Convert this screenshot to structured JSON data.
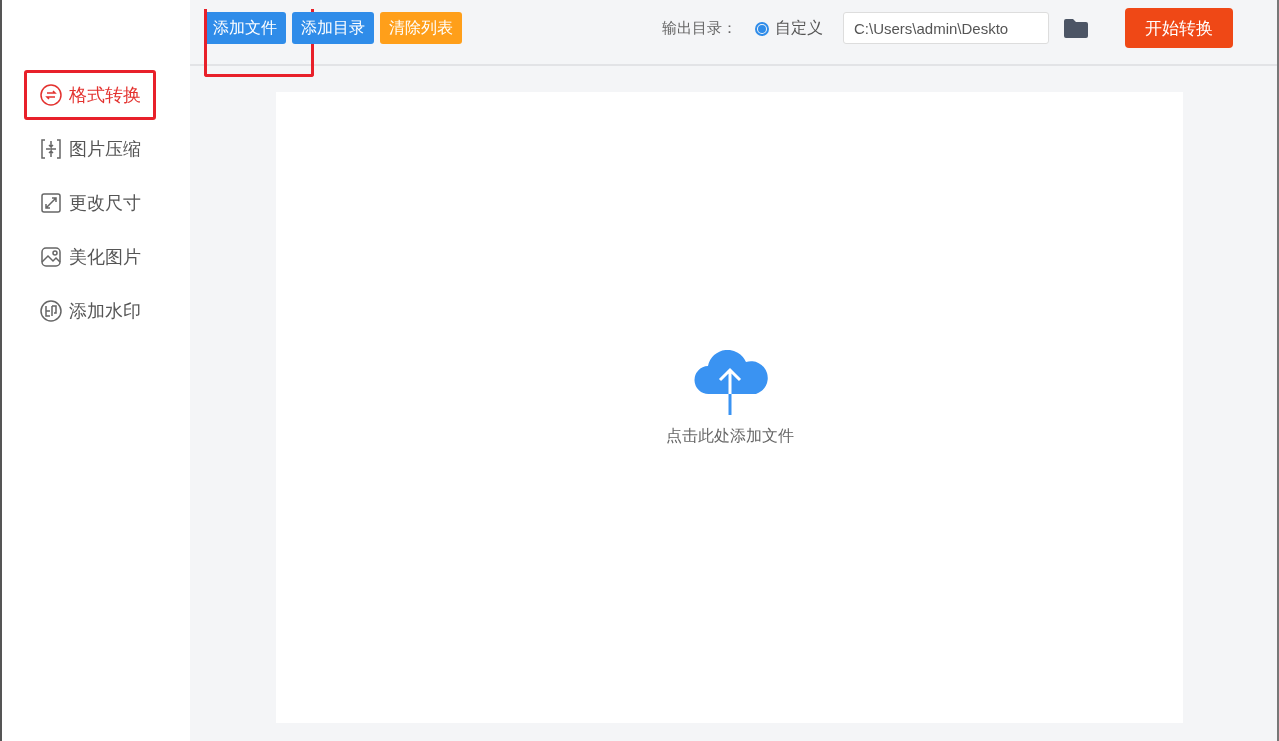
{
  "toolbar": {
    "buttons": [
      {
        "label": "添加文件",
        "kind": "primary",
        "highlighted": true
      },
      {
        "label": "添加目录",
        "kind": "primary",
        "highlighted": false
      },
      {
        "label": "清除列表",
        "kind": "warning",
        "highlighted": false
      }
    ],
    "output": {
      "label": "输出目录：",
      "option": {
        "label": "自定义",
        "selected": true
      },
      "path": "C:\\Users\\admin\\Deskto"
    },
    "start_button": "开始转换"
  },
  "sidebar": {
    "items": [
      {
        "label": "格式转换",
        "kind": "convert",
        "selected": true,
        "highlighted": true
      },
      {
        "label": "图片压缩",
        "kind": "compress",
        "selected": false,
        "highlighted": false
      },
      {
        "label": "更改尺寸",
        "kind": "resize",
        "selected": false,
        "highlighted": false
      },
      {
        "label": "美化图片",
        "kind": "beautify",
        "selected": false,
        "highlighted": false
      },
      {
        "label": "添加水印",
        "kind": "watermark",
        "selected": false,
        "highlighted": false
      }
    ]
  },
  "dropzone": {
    "hint": "点击此处添加文件"
  }
}
